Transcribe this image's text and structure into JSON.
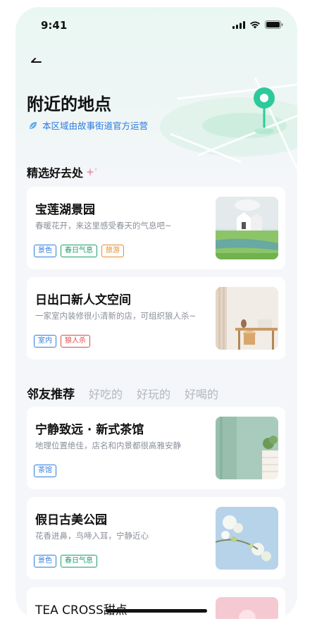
{
  "status_bar": {
    "time": "9:41"
  },
  "header": {
    "title": "附近的地点",
    "subtitle": "本区域由故事街道官方运营"
  },
  "featured": {
    "title_prefix": "精选好去",
    "title_highlight": "处",
    "cards": [
      {
        "title": "宝莲湖景园",
        "desc": "春暖花开，来这里感受春天的气息吧~",
        "tags": [
          {
            "label": "景色",
            "color": "#2e7ce0"
          },
          {
            "label": "春日气息",
            "color": "#1f9d68"
          },
          {
            "label": "旅游",
            "color": "#e88a2a"
          }
        ]
      },
      {
        "title": "日出口新人文空间",
        "desc": "一家室内装修很小清新的店，可组织狼人杀~",
        "tags": [
          {
            "label": "室内",
            "color": "#2e7ce0"
          },
          {
            "label": "狼人杀",
            "color": "#e04a4a"
          }
        ]
      }
    ]
  },
  "tabs": [
    "邻友推荐",
    "好吃的",
    "好玩的",
    "好喝的"
  ],
  "recommend": {
    "cards": [
      {
        "title": "宁静致远 · 新式茶馆",
        "desc": "地理位置绝佳，店名和内景都很高雅安静",
        "tags": [
          {
            "label": "茶馆",
            "color": "#2e7ce0"
          }
        ]
      },
      {
        "title": "假日古美公园",
        "desc": "花香进鼻，鸟啼入耳，宁静近心",
        "tags": [
          {
            "label": "景色",
            "color": "#2e7ce0"
          },
          {
            "label": "春日气息",
            "color": "#1f9d68"
          }
        ]
      },
      {
        "title": "TEA CROSS甜点"
      }
    ]
  },
  "colors": {
    "accent": "#2ec99a",
    "link_blue": "#2a7bdc"
  }
}
